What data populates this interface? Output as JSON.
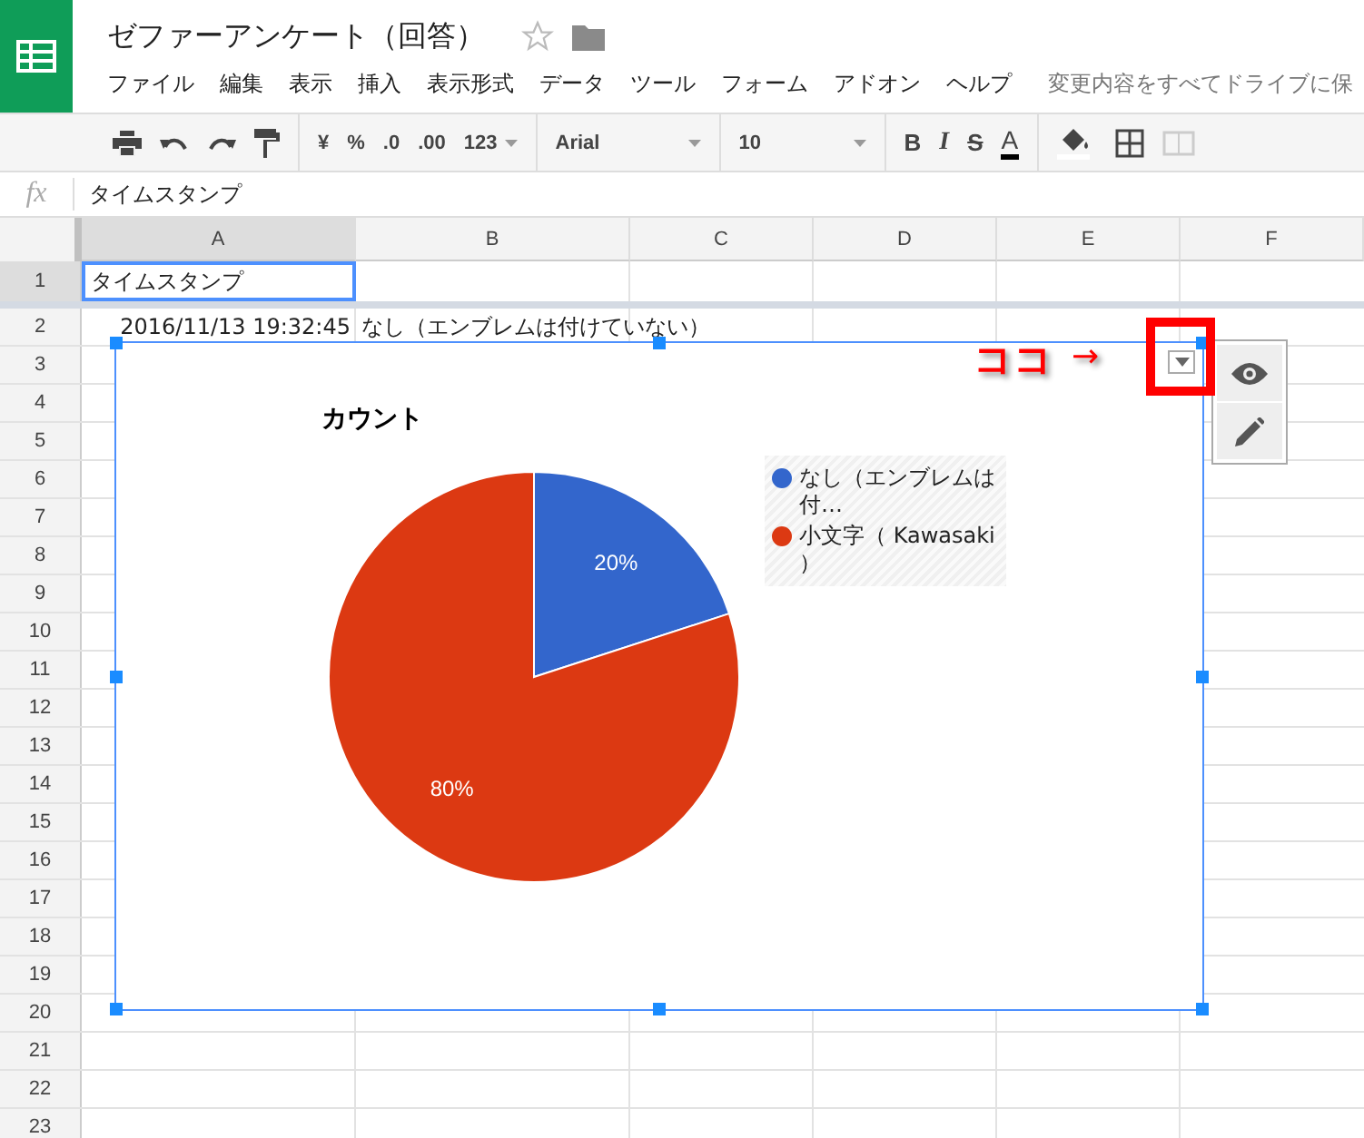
{
  "app": {
    "title": "ゼファーアンケート（回答）",
    "starred": false,
    "save_status": "変更内容をすべてドライブに保"
  },
  "menu": [
    "ファイル",
    "編集",
    "表示",
    "挿入",
    "表示形式",
    "データ",
    "ツール",
    "フォーム",
    "アドオン",
    "ヘルプ"
  ],
  "toolbar": {
    "currency": "¥",
    "percent": "%",
    "decimal_less": ".0",
    "decimal_more": ".00",
    "number_format": "123",
    "font": "Arial",
    "font_size": "10",
    "bold": "B",
    "italic": "I",
    "strikethrough": "S",
    "text_color": "A"
  },
  "formula_bar": {
    "label": "fx",
    "value": "タイムスタンプ"
  },
  "columns": [
    {
      "label": "A",
      "selected": true
    },
    {
      "label": "B",
      "selected": false
    },
    {
      "label": "C",
      "selected": false
    },
    {
      "label": "D",
      "selected": false
    },
    {
      "label": "E",
      "selected": false
    },
    {
      "label": "F",
      "selected": false
    }
  ],
  "rows": [
    {
      "number": "1",
      "selected": true,
      "cells": [
        "タイムスタンプ"
      ]
    },
    {
      "number": "2",
      "selected": false,
      "cells": [
        "2016/11/13 19:32:45",
        "なし（エンブレムは付けていない）"
      ]
    },
    {
      "number": "3",
      "selected": false,
      "cells": []
    },
    {
      "number": "4",
      "selected": false,
      "cells": []
    },
    {
      "number": "5",
      "selected": false,
      "cells": []
    },
    {
      "number": "6",
      "selected": false,
      "cells": []
    },
    {
      "number": "7",
      "selected": false,
      "cells": []
    },
    {
      "number": "8",
      "selected": false,
      "cells": []
    },
    {
      "number": "9",
      "selected": false,
      "cells": []
    },
    {
      "number": "10",
      "selected": false,
      "cells": []
    },
    {
      "number": "11",
      "selected": false,
      "cells": []
    },
    {
      "number": "12",
      "selected": false,
      "cells": []
    },
    {
      "number": "13",
      "selected": false,
      "cells": []
    },
    {
      "number": "14",
      "selected": false,
      "cells": []
    },
    {
      "number": "15",
      "selected": false,
      "cells": []
    },
    {
      "number": "16",
      "selected": false,
      "cells": []
    },
    {
      "number": "17",
      "selected": false,
      "cells": []
    },
    {
      "number": "18",
      "selected": false,
      "cells": []
    },
    {
      "number": "19",
      "selected": false,
      "cells": []
    },
    {
      "number": "20",
      "selected": false,
      "cells": []
    },
    {
      "number": "21",
      "selected": false,
      "cells": []
    },
    {
      "number": "22",
      "selected": false,
      "cells": []
    },
    {
      "number": "23",
      "selected": false,
      "cells": []
    }
  ],
  "chart": {
    "selected": true,
    "chart_data": {
      "type": "pie",
      "title": "カウント",
      "categories": [
        "なし（エンブレムは付…",
        "小文字（ Kawasaki）"
      ],
      "legend": "right",
      "values": [
        20,
        80
      ],
      "colors": [
        "#3366cc",
        "#dc3912"
      ],
      "value_labels": [
        "20%",
        "80%"
      ]
    }
  },
  "annotation": {
    "text": "ココ",
    "arrow": "→"
  }
}
